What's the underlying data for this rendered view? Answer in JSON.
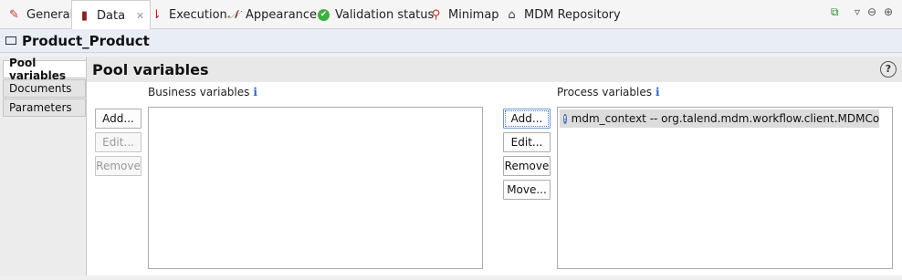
{
  "tabs": [
    {
      "label": "General",
      "icon": "pencil-icon"
    },
    {
      "label": "Data",
      "icon": "database-icon"
    },
    {
      "label": "Execution",
      "icon": "execution-icon"
    },
    {
      "label": "Appearance",
      "icon": "appearance-icon"
    },
    {
      "label": "Validation status",
      "icon": "check-circle-icon"
    },
    {
      "label": "Minimap",
      "icon": "magnifier-icon"
    },
    {
      "label": "MDM Repository",
      "icon": "home-icon"
    }
  ],
  "window_controls": {
    "menu": "▿",
    "minimize": "⊖",
    "maximize": "⊕"
  },
  "title": {
    "text": "Product_Product"
  },
  "side_tabs": [
    "Pool variables",
    "Documents",
    "Parameters"
  ],
  "panel": {
    "heading": "Pool variables",
    "help": "?",
    "business": {
      "label": "Business variables",
      "info": "i",
      "buttons": {
        "add": "Add...",
        "edit": "Edit...",
        "remove": "Remove"
      },
      "items": []
    },
    "process": {
      "label": "Process variables",
      "info": "i",
      "buttons": {
        "add": "Add...",
        "edit": "Edit...",
        "remove": "Remove",
        "move": "Move..."
      },
      "items": [
        "mdm_context -- org.talend.mdm.workflow.client.MDMContext"
      ]
    }
  }
}
